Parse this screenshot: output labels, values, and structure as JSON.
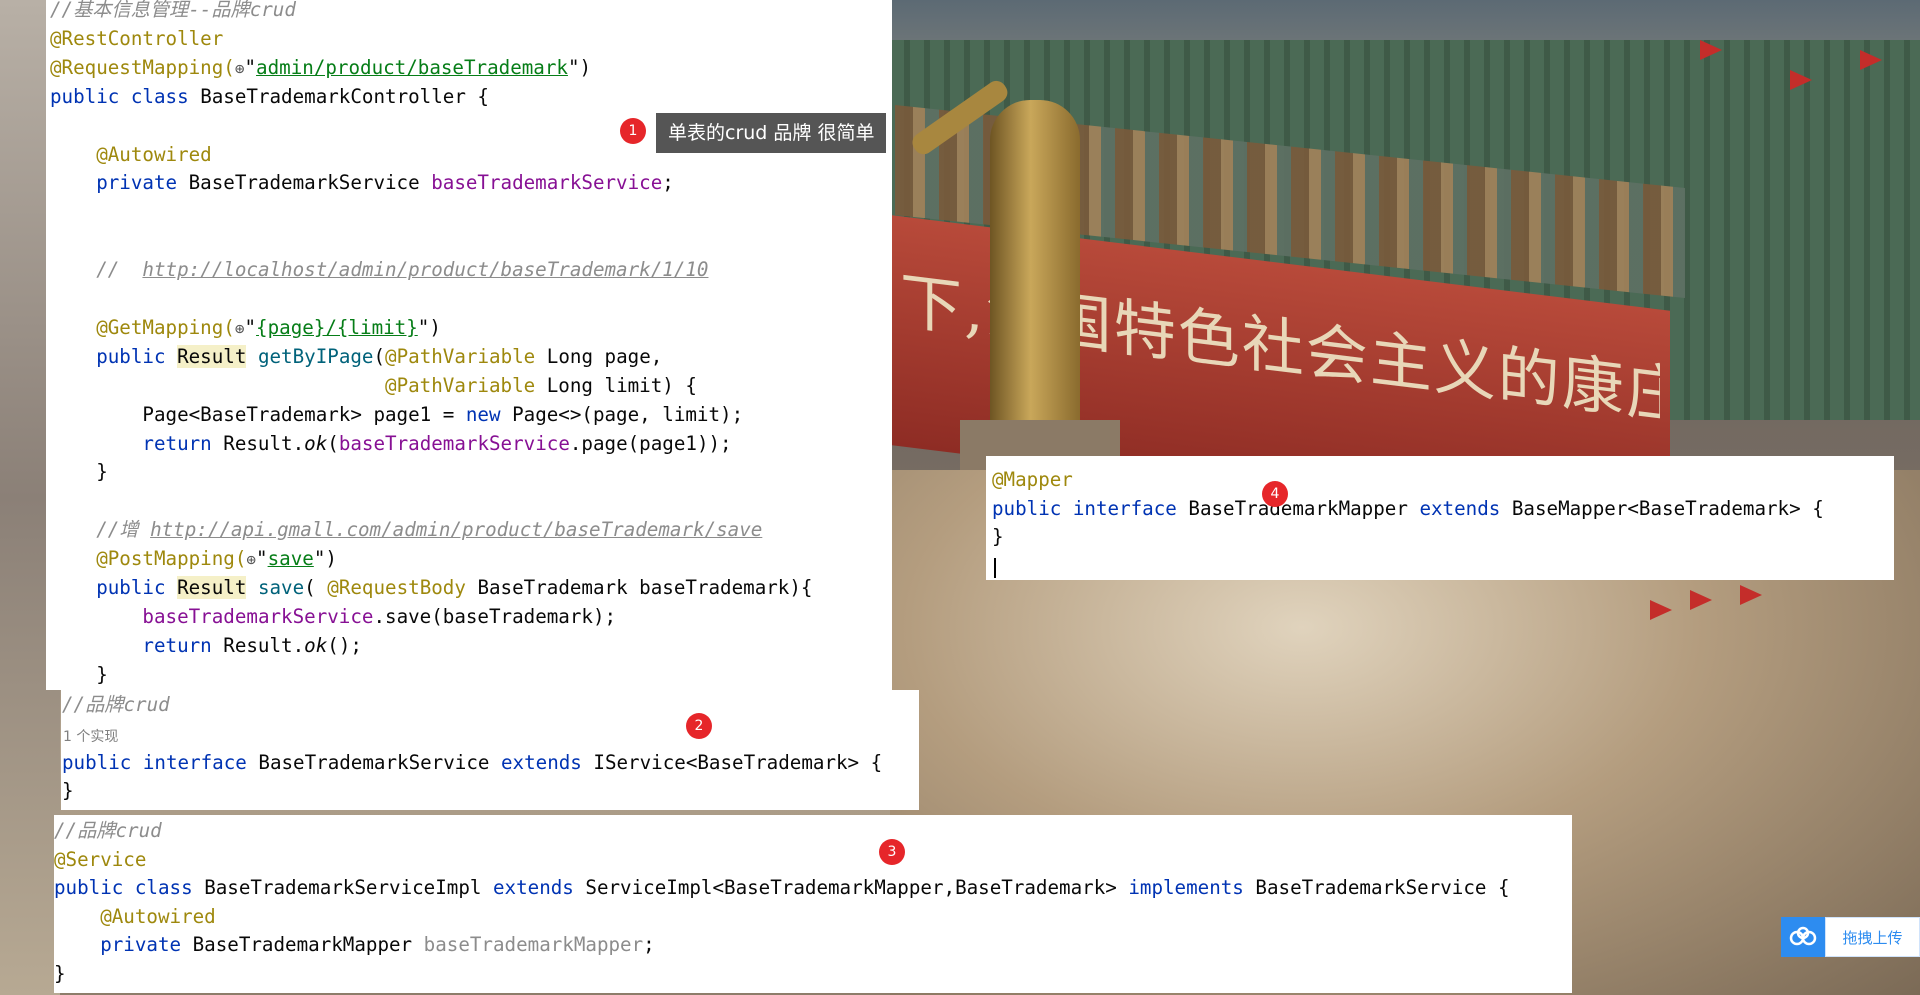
{
  "wallpaper": {
    "slogan": "下,沿国特色社会主义的康庄大道奋勇前进!"
  },
  "controller": {
    "lines": [
      [
        {
          "t": "//基本信息管理--品牌crud",
          "c": "cmt"
        }
      ],
      [
        {
          "t": "@RestController",
          "c": "ann"
        }
      ],
      [
        {
          "t": "@RequestMapping(",
          "c": "ann"
        },
        {
          "t": "⊕",
          "c": "globe"
        },
        {
          "t": "\"",
          "c": ""
        },
        {
          "t": "admin/product/baseTrademark",
          "c": "str"
        },
        {
          "t": "\")",
          "c": ""
        }
      ],
      [
        {
          "t": "public class ",
          "c": "kw"
        },
        {
          "t": "BaseTrademarkController {",
          "c": ""
        }
      ],
      [],
      [
        {
          "t": "    @Autowired",
          "c": "ann"
        }
      ],
      [
        {
          "t": "    private ",
          "c": "kw"
        },
        {
          "t": "BaseTrademarkService ",
          "c": ""
        },
        {
          "t": "baseTrademarkService",
          "c": "fld"
        },
        {
          "t": ";",
          "c": ""
        }
      ],
      [],
      [],
      [
        {
          "t": "    //  ",
          "c": "cmt"
        },
        {
          "t": "http://localhost/admin/product/baseTrademark/1/10",
          "c": "lnk"
        }
      ],
      [],
      [
        {
          "t": "    @GetMapping(",
          "c": "ann"
        },
        {
          "t": "⊕",
          "c": "globe"
        },
        {
          "t": "\"",
          "c": ""
        },
        {
          "t": "{page}/{limit}",
          "c": "str"
        },
        {
          "t": "\")",
          "c": ""
        }
      ],
      [
        {
          "t": "    public ",
          "c": "kw"
        },
        {
          "t": "Result",
          "c": "hl-type"
        },
        {
          "t": " ",
          "c": ""
        },
        {
          "t": "getByIPage",
          "c": "mth"
        },
        {
          "t": "(",
          "c": ""
        },
        {
          "t": "@PathVariable",
          "c": "ann"
        },
        {
          "t": " Long page,",
          "c": ""
        }
      ],
      [
        {
          "t": "                             ",
          "c": ""
        },
        {
          "t": "@PathVariable",
          "c": "ann"
        },
        {
          "t": " Long limit) {",
          "c": ""
        }
      ],
      [
        {
          "t": "        Page<BaseTrademark> page1 = ",
          "c": ""
        },
        {
          "t": "new ",
          "c": "kw"
        },
        {
          "t": "Page<>(page, limit);",
          "c": ""
        }
      ],
      [
        {
          "t": "        return ",
          "c": "kw"
        },
        {
          "t": "Result.",
          "c": ""
        },
        {
          "t": "ok",
          "c": "ital"
        },
        {
          "t": "(",
          "c": ""
        },
        {
          "t": "baseTrademarkService",
          "c": "fld"
        },
        {
          "t": ".page(page1));",
          "c": ""
        }
      ],
      [
        {
          "t": "    }",
          "c": ""
        }
      ],
      [],
      [
        {
          "t": "    //增 ",
          "c": "cmt"
        },
        {
          "t": "http://api.gmall.com/admin/product/baseTrademark/save",
          "c": "lnk"
        }
      ],
      [
        {
          "t": "    @PostMapping(",
          "c": "ann"
        },
        {
          "t": "⊕",
          "c": "globe"
        },
        {
          "t": "\"",
          "c": ""
        },
        {
          "t": "save",
          "c": "str"
        },
        {
          "t": "\")",
          "c": ""
        }
      ],
      [
        {
          "t": "    public ",
          "c": "kw"
        },
        {
          "t": "Result",
          "c": "hl-type"
        },
        {
          "t": " ",
          "c": ""
        },
        {
          "t": "save",
          "c": "mth"
        },
        {
          "t": "( ",
          "c": ""
        },
        {
          "t": "@RequestBody",
          "c": "ann"
        },
        {
          "t": " BaseTrademark baseTrademark){",
          "c": ""
        }
      ],
      [
        {
          "t": "        ",
          "c": ""
        },
        {
          "t": "baseTrademarkService",
          "c": "fld"
        },
        {
          "t": ".save(baseTrademark);",
          "c": ""
        }
      ],
      [
        {
          "t": "        return ",
          "c": "kw"
        },
        {
          "t": "Result.",
          "c": ""
        },
        {
          "t": "ok",
          "c": "ital"
        },
        {
          "t": "();",
          "c": ""
        }
      ],
      [
        {
          "t": "    }",
          "c": ""
        }
      ]
    ]
  },
  "service": {
    "hint": "1 个实现",
    "lines": [
      [
        {
          "t": "//品牌crud",
          "c": "cmt"
        }
      ],
      [],
      [
        {
          "t": "public interface ",
          "c": "kw"
        },
        {
          "t": "BaseTrademarkService ",
          "c": ""
        },
        {
          "t": "extends ",
          "c": "kw"
        },
        {
          "t": "IService<BaseTrademark> {",
          "c": ""
        }
      ],
      [
        {
          "t": "}",
          "c": ""
        }
      ]
    ]
  },
  "impl": {
    "lines": [
      [
        {
          "t": "//品牌crud",
          "c": "cmt"
        }
      ],
      [
        {
          "t": "@Service",
          "c": "ann"
        }
      ],
      [
        {
          "t": "public class ",
          "c": "kw"
        },
        {
          "t": "BaseTrademarkServiceImpl ",
          "c": ""
        },
        {
          "t": "extends ",
          "c": "kw"
        },
        {
          "t": "ServiceImpl<BaseTrademarkMapper,BaseTrademark> ",
          "c": ""
        },
        {
          "t": "implements ",
          "c": "kw"
        },
        {
          "t": "BaseTrademarkService {",
          "c": ""
        }
      ],
      [
        {
          "t": "    @Autowired",
          "c": "ann"
        }
      ],
      [
        {
          "t": "    private ",
          "c": "kw"
        },
        {
          "t": "BaseTrademarkMapper ",
          "c": ""
        },
        {
          "t": "baseTrademarkMapper",
          "c": "grey"
        },
        {
          "t": ";",
          "c": ""
        }
      ],
      [
        {
          "t": "}",
          "c": ""
        }
      ]
    ]
  },
  "mapper": {
    "lines": [
      [
        {
          "t": "@Mapper",
          "c": "ann"
        }
      ],
      [
        {
          "t": "public interface ",
          "c": "kw"
        },
        {
          "t": "BaseTrademarkMapper ",
          "c": ""
        },
        {
          "t": "extends ",
          "c": "kw"
        },
        {
          "t": "BaseMapper<BaseTrademark> {",
          "c": ""
        }
      ],
      [
        {
          "t": "}",
          "c": ""
        }
      ]
    ]
  },
  "annotations": {
    "badge1": "1",
    "badge2": "2",
    "badge3": "3",
    "badge4": "4",
    "tooltip1": "单表的crud  品牌 很简单"
  },
  "upload": {
    "label": "拖拽上传",
    "icon": "cloud-icon"
  },
  "colors": {
    "badge": "#e6262a",
    "keyword": "#0033b3",
    "annotation": "#9e880d",
    "string": "#067d17",
    "field": "#871094",
    "method": "#00627a",
    "comment": "#8c8c8c",
    "upload_accent": "#2d8cf0"
  }
}
